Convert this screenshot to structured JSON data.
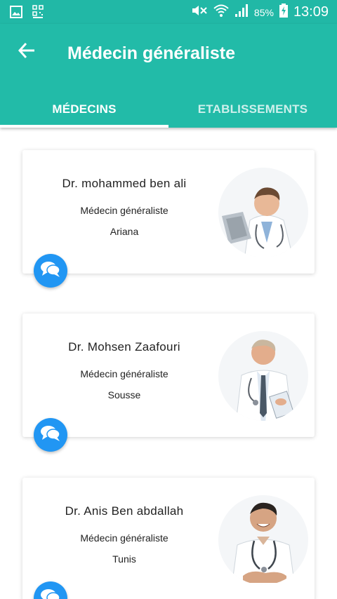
{
  "status_bar": {
    "time": "13:09",
    "battery": "85%",
    "left_icons": [
      "image-icon",
      "qr-icon"
    ],
    "right_icons": [
      "mute-icon",
      "wifi-icon",
      "signal-icon",
      "battery-charging-icon"
    ]
  },
  "appbar": {
    "title": "Médecin généraliste",
    "back_icon": "arrow-left-icon",
    "background": "#22bba8"
  },
  "tabs": [
    {
      "label": "MÉDECINS",
      "active": true
    },
    {
      "label": "ETABLISSEMENTS",
      "active": false
    }
  ],
  "doctors": [
    {
      "name": "Dr. mohammed ben ali",
      "specialty": "Médecin généraliste",
      "city": "Ariana"
    },
    {
      "name": "Dr. Mohsen Zaafouri",
      "specialty": "Médecin généraliste",
      "city": "Sousse"
    },
    {
      "name": "Dr. Anis Ben abdallah",
      "specialty": "Médecin généraliste",
      "city": "Tunis"
    }
  ],
  "colors": {
    "primary": "#22bba8",
    "chat_button": "#2196f3"
  }
}
